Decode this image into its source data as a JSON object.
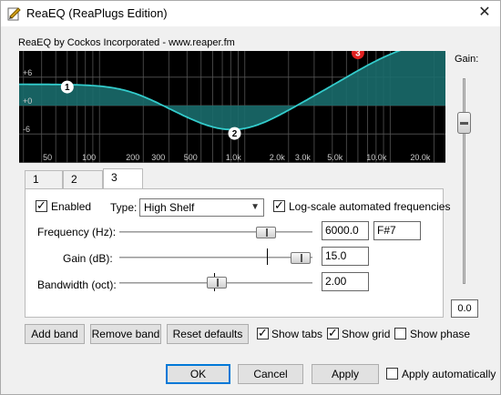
{
  "window": {
    "title": "ReaEQ (ReaPlugs Edition)",
    "header": "ReaEQ by Cockos Incorporated - www.reaper.fm",
    "close_label": "✕"
  },
  "display": {
    "gain_ticks": [
      "+6",
      "+0",
      "-6"
    ],
    "freq_ticks": [
      "50",
      "100",
      "200",
      "300",
      "500",
      "1.0k",
      "2.0k",
      "3.0k",
      "5.0k",
      "10.0k",
      "20.0k"
    ],
    "bands": [
      {
        "number": "1",
        "freq_hz": 60,
        "gain_db": 4.5
      },
      {
        "number": "2",
        "freq_hz": 850,
        "gain_db": -5.5
      },
      {
        "number": "3",
        "freq_hz": 6000,
        "gain_db": 15.0
      }
    ],
    "curve_color": "#33cccc",
    "fill_color": "#1a6b6b"
  },
  "gain": {
    "label": "Gain:",
    "value": "0.0"
  },
  "tabs": [
    "1",
    "2",
    "3"
  ],
  "active_tab": "3",
  "band": {
    "enabled_label": "Enabled",
    "enabled": true,
    "type_label": "Type:",
    "type_value": "High Shelf",
    "log_scale_label": "Log-scale automated frequencies",
    "log_scale": true,
    "frequency_label": "Frequency (Hz):",
    "frequency_value": "6000.0",
    "note_value": "F#7",
    "gain_label": "Gain (dB):",
    "gain_value": "15.0",
    "bandwidth_label": "Bandwidth (oct):",
    "bandwidth_value": "2.00"
  },
  "buttons": {
    "add_band": "Add band",
    "remove_band": "Remove band",
    "reset_defaults": "Reset defaults",
    "ok": "OK",
    "cancel": "Cancel",
    "apply": "Apply"
  },
  "options": {
    "show_tabs": "Show tabs",
    "show_tabs_checked": true,
    "show_grid": "Show grid",
    "show_grid_checked": true,
    "show_phase": "Show phase",
    "show_phase_checked": false,
    "apply_auto": "Apply automatically",
    "apply_auto_checked": false
  }
}
